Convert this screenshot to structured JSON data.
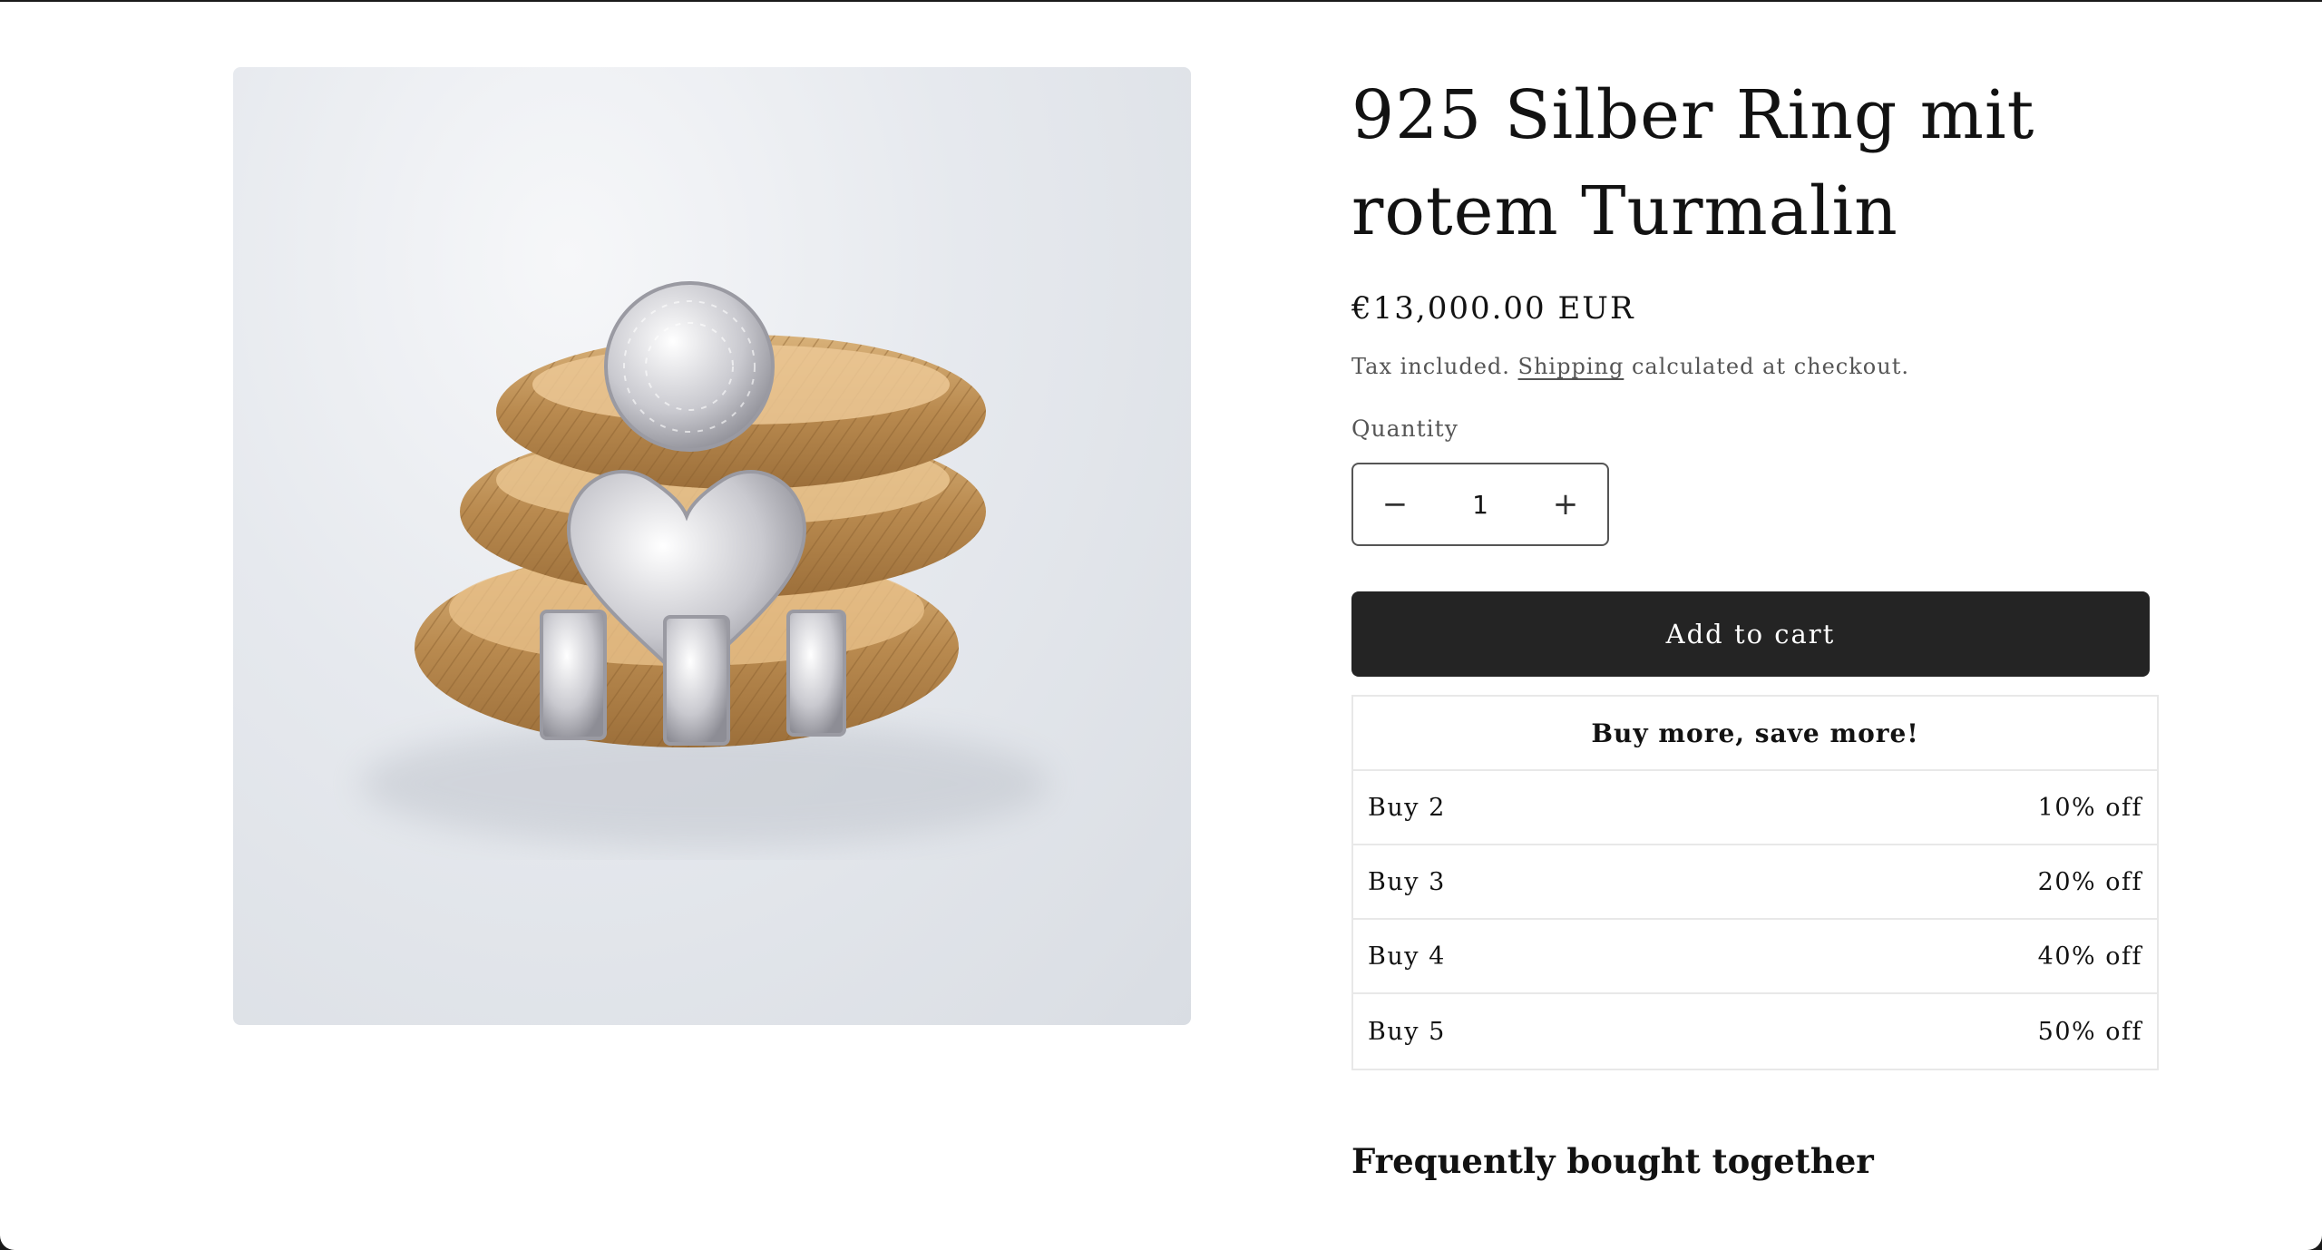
{
  "product": {
    "title": "925 Silber Ring mit rotem Turmalin",
    "price": "€13,000.00 EUR",
    "tax_prefix": "Tax included.",
    "tax_link": "Shipping",
    "tax_suffix": "calculated at checkout.",
    "image_alt": "Gold mesh rings with diamond circle and heart charms"
  },
  "quantity": {
    "label": "Quantity",
    "value": "1",
    "decrease_symbol": "−",
    "increase_symbol": "+"
  },
  "cart": {
    "add_label": "Add to cart"
  },
  "discount": {
    "heading": "Buy more, save more!",
    "tiers": [
      {
        "label": "Buy 2",
        "value": "10% off"
      },
      {
        "label": "Buy 3",
        "value": "20% off"
      },
      {
        "label": "Buy 4",
        "value": "40% off"
      },
      {
        "label": "Buy 5",
        "value": "50% off"
      }
    ]
  },
  "related": {
    "heading": "Frequently bought together"
  },
  "colors": {
    "button_bg": "#242424",
    "gold": "#c99a5b",
    "border": "#e8e8e8"
  }
}
